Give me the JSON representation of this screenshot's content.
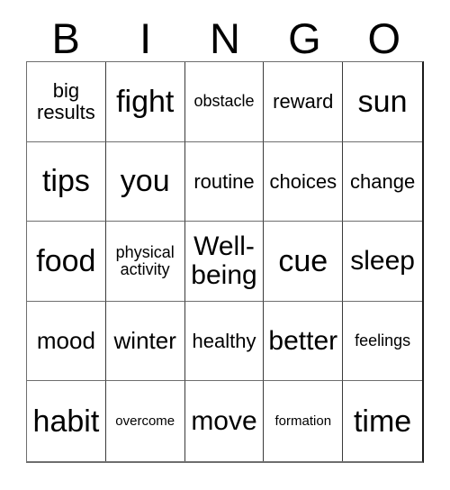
{
  "card": {
    "title_letters": [
      "B",
      "I",
      "N",
      "G",
      "O"
    ],
    "columns": 5,
    "rows": 5,
    "grid_line_color": "#6e6e6e",
    "text_color": "#000000",
    "background_color": "#ffffff",
    "cells": [
      [
        {
          "text": "big\nresults",
          "size": "md"
        },
        {
          "text": "fight",
          "size": "xxl"
        },
        {
          "text": "obstacle",
          "size": "sm"
        },
        {
          "text": "reward",
          "size": "md"
        },
        {
          "text": "sun",
          "size": "xxl"
        }
      ],
      [
        {
          "text": "tips",
          "size": "xxl"
        },
        {
          "text": "you",
          "size": "xxl"
        },
        {
          "text": "routine",
          "size": "md"
        },
        {
          "text": "choices",
          "size": "md"
        },
        {
          "text": "change",
          "size": "md"
        }
      ],
      [
        {
          "text": "food",
          "size": "xxl"
        },
        {
          "text": "physical\nactivity",
          "size": "sm"
        },
        {
          "text": "Well-\nbeing",
          "size": "xl"
        },
        {
          "text": "cue",
          "size": "xxl"
        },
        {
          "text": "sleep",
          "size": "xl"
        }
      ],
      [
        {
          "text": "mood",
          "size": "lg"
        },
        {
          "text": "winter",
          "size": "lg"
        },
        {
          "text": "healthy",
          "size": "md"
        },
        {
          "text": "better",
          "size": "xl"
        },
        {
          "text": "feelings",
          "size": "sm"
        }
      ],
      [
        {
          "text": "habit",
          "size": "xxl"
        },
        {
          "text": "overcome",
          "size": "xs"
        },
        {
          "text": "move",
          "size": "xl"
        },
        {
          "text": "formation",
          "size": "xs"
        },
        {
          "text": "time",
          "size": "xxl"
        }
      ]
    ]
  }
}
